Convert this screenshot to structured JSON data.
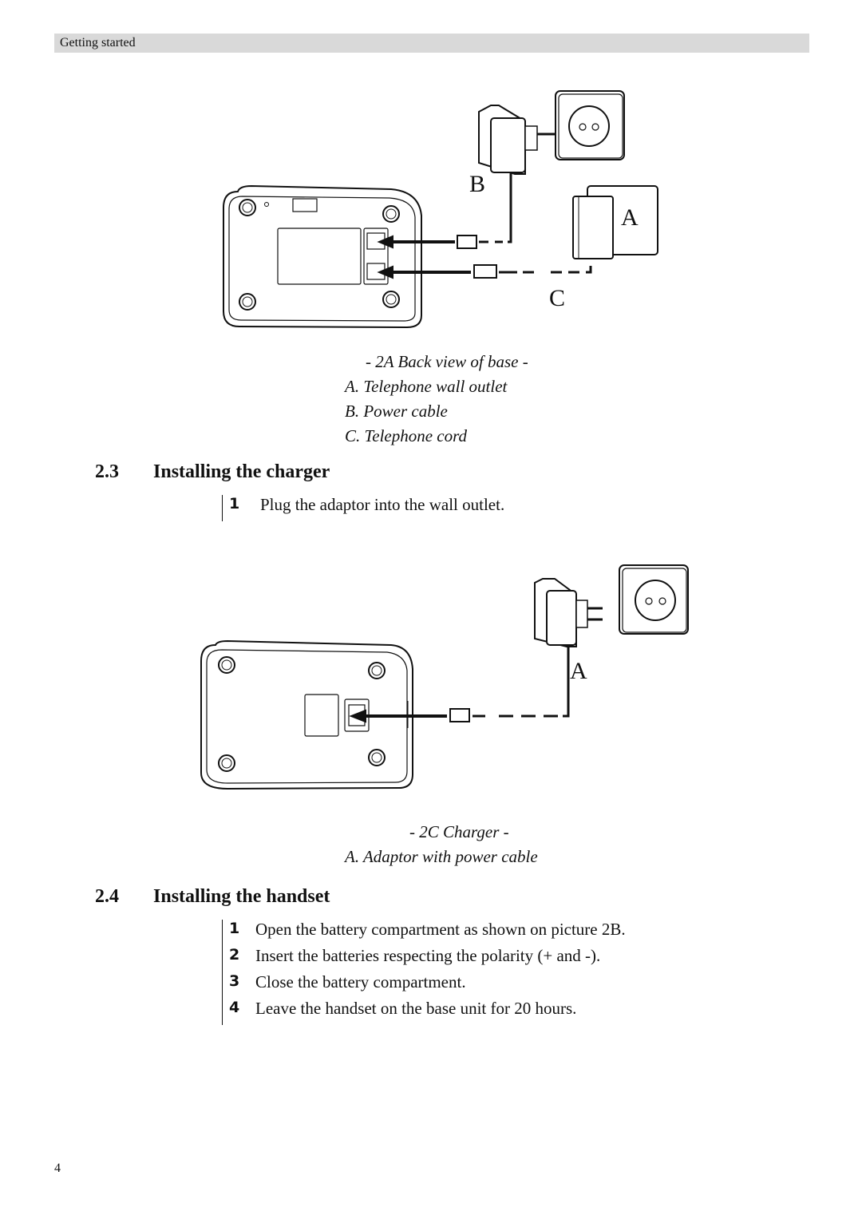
{
  "header": {
    "title": "Getting started"
  },
  "figure_2a": {
    "labels": {
      "a": "A",
      "b": "B",
      "c": "C"
    },
    "caption_title": "- 2A Back view of base -",
    "legend": [
      "A.  Telephone wall outlet",
      "B.  Power cable",
      "C.  Telephone cord"
    ]
  },
  "section_2_3": {
    "number": "2.3",
    "title": "Installing the charger",
    "steps": [
      {
        "n": "1",
        "text": "Plug the adaptor into the wall outlet."
      }
    ]
  },
  "figure_2c": {
    "labels": {
      "a": "A"
    },
    "caption_title": "- 2C Charger -",
    "legend": [
      "A.  Adaptor with power cable"
    ]
  },
  "section_2_4": {
    "number": "2.4",
    "title": "Installing the handset",
    "steps": [
      {
        "n": "1",
        "text": "Open the battery compartment as shown on picture 2B."
      },
      {
        "n": "2",
        "text": "Insert the batteries respecting the polarity (+ and -)."
      },
      {
        "n": "3",
        "text": "Close the battery compartment."
      },
      {
        "n": "4",
        "text": "Leave the handset on the base unit for 20 hours."
      }
    ]
  },
  "footer": {
    "page_number": "4"
  }
}
